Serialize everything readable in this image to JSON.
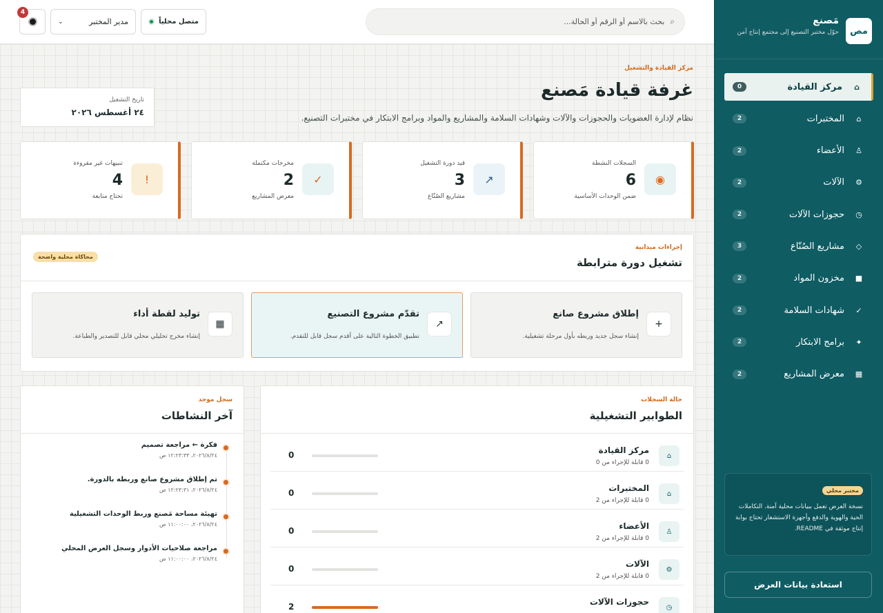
{
  "topbar": {
    "search_placeholder": "بحث بالاسم أو الرقم أو الحالة...",
    "status_label": "متصل محلياً",
    "role_select": "مدير المختبر",
    "notifications_count": "4"
  },
  "sidebar": {
    "logo_text": "مص",
    "brand_name": "مَصنع",
    "brand_tagline": "حوّل مختبر التصنيع إلى مجتمع إنتاج آمن",
    "items": [
      {
        "label": "مركز القيادة",
        "count": "0",
        "icon": "⌂"
      },
      {
        "label": "المختبرات",
        "count": "2",
        "icon": "⌂"
      },
      {
        "label": "الأعضاء",
        "count": "2",
        "icon": "♙"
      },
      {
        "label": "الآلات",
        "count": "2",
        "icon": "⚙"
      },
      {
        "label": "حجوزات الآلات",
        "count": "2",
        "icon": "◷"
      },
      {
        "label": "مشاريع الصُنّاع",
        "count": "3",
        "icon": "◇"
      },
      {
        "label": "مخزون المواد",
        "count": "2",
        "icon": "■"
      },
      {
        "label": "شهادات السلامة",
        "count": "2",
        "icon": "✓"
      },
      {
        "label": "برامج الابتكار",
        "count": "2",
        "icon": "✦"
      },
      {
        "label": "معرض المشاريع",
        "count": "2",
        "icon": "▦"
      }
    ],
    "note_badge": "مختبر محلي",
    "note_text": "نسخة العرض تعمل ببيانات محلية آمنة. التكاملات الحية والهوية والدفع وأجهزة الاستشعار تحتاج بوابة إنتاج موثقة في README.",
    "restore_button": "استعادة بيانات العرض"
  },
  "header": {
    "eyebrow": "مركز القيادة والتشغيل",
    "title": "غرفة قيادة مَصنع",
    "description": "نظام لإدارة العضويات والحجوزات والآلات وشهادات السلامة والمشاريع والمواد وبرامج الابتكار في مختبرات التصنيع.",
    "date_label": "تاريخ التشغيل",
    "date_value": "٢٤ أغسطس ٢٠٢٦"
  },
  "stats": [
    {
      "label": "السجلات النشطة",
      "value": "6",
      "sub": "ضمن الوحدات الأساسية",
      "icon": "target-icon",
      "glyph": "◉",
      "color": "#e26a1c",
      "bg": "#e7f4f3"
    },
    {
      "label": "قيد دورة التشغيل",
      "value": "3",
      "sub": "مشاريع الصُنّاع",
      "icon": "arrow-up-right-icon",
      "glyph": "↗",
      "color": "#2c5a8a",
      "bg": "#eaf3f8"
    },
    {
      "label": "مخرجات مكتملة",
      "value": "2",
      "sub": "معرض المشاريع",
      "icon": "check-icon",
      "glyph": "✓",
      "color": "#d9691f",
      "bg": "#e7f4f3"
    },
    {
      "label": "تنبيهات غير مقروءة",
      "value": "4",
      "sub": "تحتاج متابعة",
      "icon": "alert-icon",
      "glyph": "!",
      "color": "#d9691f",
      "bg": "#fbeed7"
    }
  ],
  "flow": {
    "eyebrow": "إجراءات ميدانية",
    "title": "تشغيل دورة مترابطة",
    "badge": "محاكاة محلية واضحة",
    "actions": [
      {
        "title": "إطلاق مشروع صانع",
        "desc": "إنشاء سجل جديد وربطه بأول مرحلة تشغيلية.",
        "glyph": "+"
      },
      {
        "title": "تقدّم مشروع التصنيع",
        "desc": "تطبيق الخطوة التالية على أقدم سجل قابل للتقدم.",
        "glyph": "↗"
      },
      {
        "title": "توليد لقطة أداء",
        "desc": "إنشاء مخرج تحليلي محلي قابل للتصدير والطباعة.",
        "glyph": "▦"
      }
    ]
  },
  "queues": {
    "eyebrow": "حالة السجلات",
    "title": "الطوابير التشغيلية",
    "rows": [
      {
        "name": "مركز القيادة",
        "sub": "0 قابلة للإجراء من 0",
        "count": "0",
        "progress": 0,
        "glyph": "⌂"
      },
      {
        "name": "المختبرات",
        "sub": "0 قابلة للإجراء من 2",
        "count": "0",
        "progress": 0,
        "glyph": "⌂"
      },
      {
        "name": "الأعضاء",
        "sub": "0 قابلة للإجراء من 2",
        "count": "0",
        "progress": 0,
        "glyph": "♙"
      },
      {
        "name": "الآلات",
        "sub": "0 قابلة للإجراء من 2",
        "count": "0",
        "progress": 0,
        "glyph": "⚙"
      },
      {
        "name": "حجوزات الآلات",
        "sub": "",
        "count": "2",
        "progress": 1,
        "glyph": "◷"
      }
    ]
  },
  "activity": {
    "eyebrow": "سجل موحد",
    "title": "آخر النشاطات",
    "items": [
      {
        "title": "فكرة ← مراجعة تصميم",
        "time": "٢٠٢٦/٨/٢٤، ١٢:٢٣:٣٣ ص"
      },
      {
        "title": "تم إطلاق مشروع صانع وربطه بالدورة.",
        "time": "٢٠٢٦/٨/٢٤، ١٢:٢٣:٣١ ص"
      },
      {
        "title": "تهيئة مساحة مَصنع وربط الوحدات التشغيلية",
        "time": "٢٠٢٦/٨/٢٤، ١١:٠٠:٠٠ ص"
      },
      {
        "title": "مراجعة صلاحيات الأدوار وسجل العرض المحلي",
        "time": "٢٠٢٦/٨/٢٤، ١١:٠٠:٠٠ ص"
      }
    ]
  }
}
